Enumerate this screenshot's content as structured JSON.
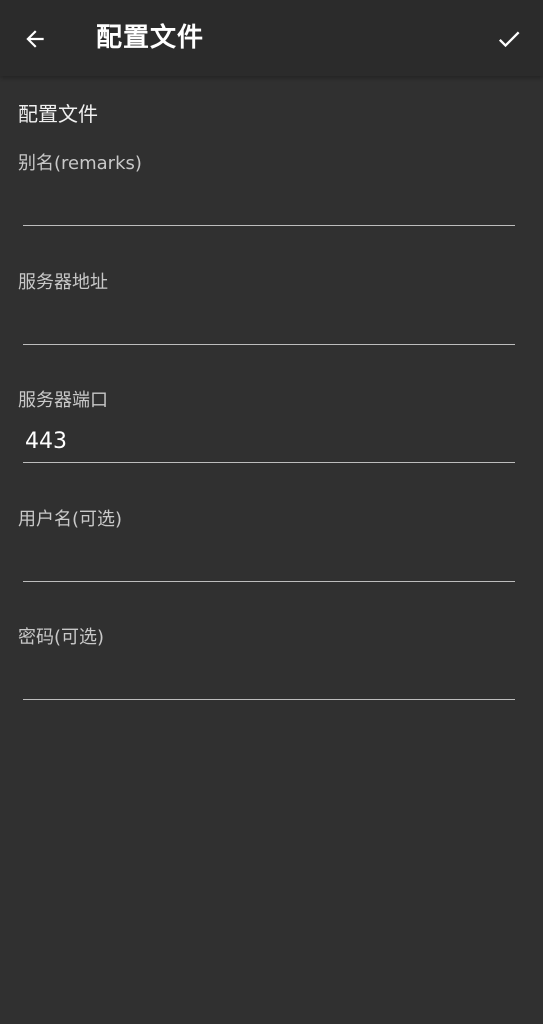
{
  "appbar": {
    "title": "配置文件",
    "back_icon": "arrow-left-icon",
    "confirm_icon": "check-icon"
  },
  "section": {
    "title": "配置文件"
  },
  "fields": {
    "remarks": {
      "label": "别名(remarks)",
      "value": ""
    },
    "server_address": {
      "label": "服务器地址",
      "value": ""
    },
    "server_port": {
      "label": "服务器端口",
      "value": "443"
    },
    "username": {
      "label": "用户名(可选)",
      "value": ""
    },
    "password": {
      "label": "密码(可选)",
      "value": ""
    }
  },
  "colors": {
    "background": "#303030",
    "appbar": "#2b2b2b",
    "underline": "#bdbdbd"
  }
}
